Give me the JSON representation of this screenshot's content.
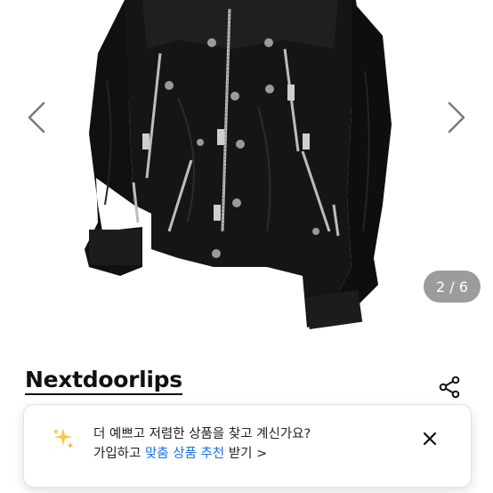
{
  "gallery": {
    "image_alt": "black zip-detail jacket",
    "counter": "2 / 6",
    "prev_icon": "chevron-left-icon",
    "next_icon": "chevron-right-icon"
  },
  "shop": {
    "name": "Nextdoorlips",
    "share_icon": "share-icon"
  },
  "promo": {
    "line1": "더 예쁘고 저렴한 상품을 찾고 계신가요?",
    "line2_prefix": "가입하고 ",
    "line2_highlight": "맞춤 상품 추천",
    "line2_suffix": " 받기 >",
    "highlight_color": "#1a73e8",
    "sparkle_icon": "sparkle-icon",
    "close_icon": "close-icon"
  }
}
